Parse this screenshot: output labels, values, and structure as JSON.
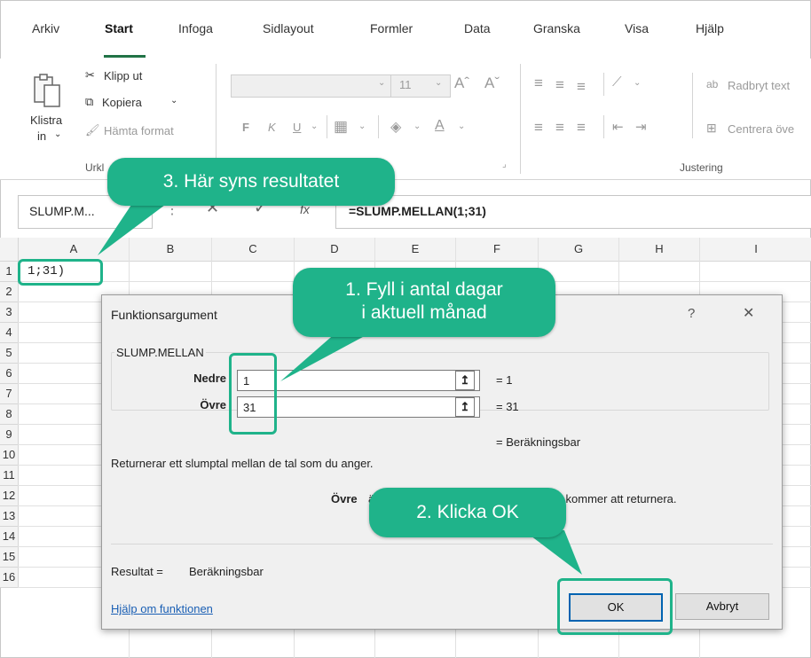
{
  "menu": {
    "items": [
      "Arkiv",
      "Start",
      "Infoga",
      "Sidlayout",
      "Formler",
      "Data",
      "Granska",
      "Visa",
      "Hjälp"
    ]
  },
  "ribbon": {
    "paste_label_1": "Klistra",
    "paste_label_2": "in",
    "cut": "Klipp ut",
    "copy": "Kopiera",
    "format_painter": "Hämta format",
    "clipboard_group": "Urkl",
    "font_size": "11",
    "bold": "F",
    "italic": "K",
    "underline": "U",
    "wrap_text": "Radbryt text",
    "merge_center": "Centrera öve",
    "alignment_group": "Justering"
  },
  "formula_bar": {
    "name_box": "SLUMP.M...",
    "formula": "=SLUMP.MELLAN(1;31)"
  },
  "grid": {
    "columns": [
      "A",
      "B",
      "C",
      "D",
      "E",
      "F",
      "G",
      "H",
      "I"
    ],
    "rows": [
      "1",
      "2",
      "3",
      "4",
      "5",
      "6",
      "7",
      "8",
      "9",
      "10",
      "11",
      "12",
      "13",
      "14",
      "15",
      "16"
    ],
    "cell_a1": "1;31)"
  },
  "dialog": {
    "title": "Funktionsargument",
    "help_glyph": "?",
    "close_glyph": "✕",
    "function_name": "SLUMP.MELLAN",
    "arg1_label": "Nedre",
    "arg1_value": "1",
    "arg1_result": "=  1",
    "arg2_label": "Övre",
    "arg2_value": "31",
    "arg2_result": "=  31",
    "computed": "=  Beräkningsbar",
    "description": "Returnerar ett slumptal mellan de tal som du anger.",
    "arg_help_label": "Övre",
    "arg_help_text": "är det största heltal som slump.mellan kommer att returnera.",
    "result_label": "Resultat =",
    "result_value": "Beräkningsbar",
    "help_link": "Hjälp om funktionen",
    "ok": "OK",
    "cancel": "Avbryt"
  },
  "callouts": {
    "step1_line1": "1. Fyll i antal dagar",
    "step1_line2": "i aktuell månad",
    "step2": "2. Klicka OK",
    "step3": "3. Här syns resultatet"
  },
  "colors": {
    "accent": "#217346",
    "callout": "#1fb38a",
    "link": "#1a5fb4"
  }
}
